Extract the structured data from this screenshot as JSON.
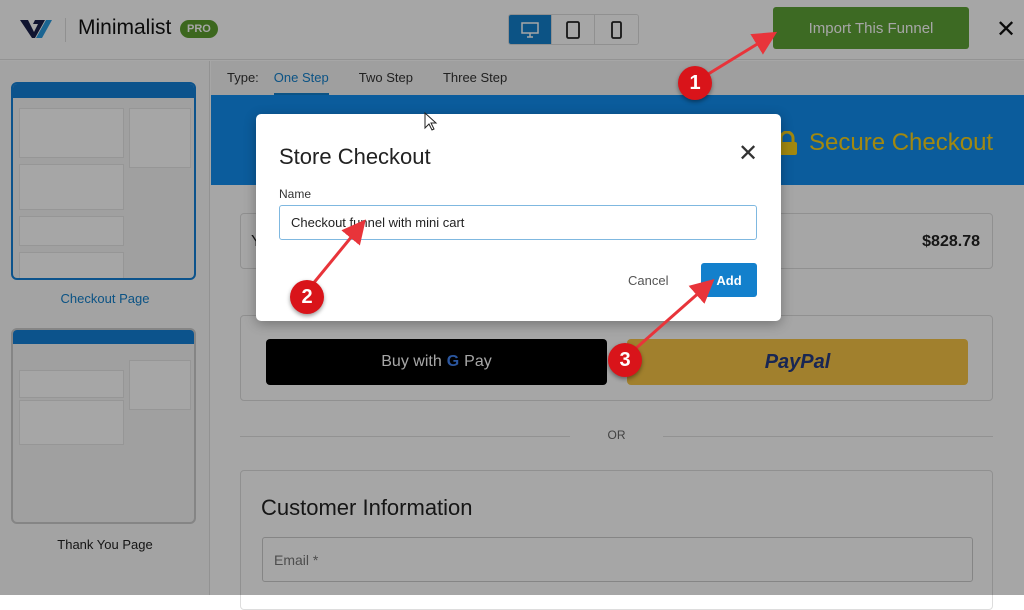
{
  "header": {
    "title": "Minimalist",
    "badge": "PRO",
    "import_label": "Import This Funnel",
    "devices": [
      "desktop-icon",
      "tablet-icon",
      "mobile-icon"
    ],
    "active_device": "desktop"
  },
  "sidebar": {
    "templates": [
      {
        "label": "Checkout Page",
        "selected": true
      },
      {
        "label": "Thank You Page",
        "selected": false
      }
    ]
  },
  "tabs": {
    "type_label": "Type:",
    "items": [
      "One Step",
      "Two Step",
      "Three Step"
    ],
    "active": "One Step"
  },
  "preview": {
    "banner_text": "Secure Checkout",
    "order_prefix": "Y",
    "order_total": "$828.78",
    "gpay_label": "Buy with",
    "gpay_brand": "Pay",
    "paypal_label": "PayPal",
    "or_label": "OR",
    "customer_info_title": "Customer Information",
    "email_placeholder": "Email *"
  },
  "modal": {
    "title": "Store Checkout",
    "name_label": "Name",
    "name_value": "Checkout funnel with mini cart",
    "cancel_label": "Cancel",
    "add_label": "Add"
  },
  "annotations": [
    "1",
    "2",
    "3"
  ],
  "colors": {
    "accent": "#1380cc",
    "import_green": "#5fa336",
    "banner_blue": "#128ef0",
    "annotation_red": "#d9141a",
    "secure_yellow": "#f7d21a"
  }
}
